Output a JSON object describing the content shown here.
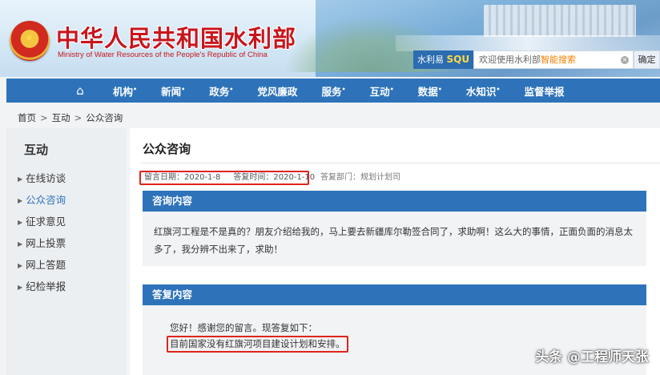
{
  "header": {
    "title": "中华人民共和国水利部",
    "subtitle": "Ministry of Water Resources of the People's Republic of China",
    "emblem_icon": "national-emblem-icon",
    "search": {
      "brand_prefix": "水利易",
      "brand_suffix": "SQU",
      "placeholder_prefix": "欢迎使用水利部",
      "placeholder_highlight": "智能搜索",
      "clear_icon": "close-icon",
      "button": "确定"
    }
  },
  "nav": {
    "home_icon": "home-icon",
    "items": [
      {
        "label": "机构",
        "mark": "•"
      },
      {
        "label": "新闻",
        "mark": "•"
      },
      {
        "label": "政务",
        "mark": "•"
      },
      {
        "label": "党风廉政",
        "mark": ""
      },
      {
        "label": "服务",
        "mark": "•"
      },
      {
        "label": "互动",
        "mark": "•"
      },
      {
        "label": "数据",
        "mark": "•"
      },
      {
        "label": "水知识",
        "mark": "•"
      },
      {
        "label": "监督举报",
        "mark": ""
      }
    ]
  },
  "breadcrumb": [
    "首页",
    "互动",
    "公众咨询"
  ],
  "sidebar": {
    "title": "互动",
    "items": [
      {
        "label": "在线访谈"
      },
      {
        "label": "公众咨询"
      },
      {
        "label": "征求意见"
      },
      {
        "label": "网上投票"
      },
      {
        "label": "网上答题"
      },
      {
        "label": "纪检举报"
      }
    ],
    "active_index": 1
  },
  "main": {
    "title": "公众咨询",
    "meta": {
      "message_date": "留言日期：2020-1-8",
      "reply_date": "答复时间：2020-1-10",
      "department": "答复部门：规划计划司"
    },
    "question": {
      "heading": "咨询内容",
      "text": "红旗河工程是不是真的？朋友介绍给我的，马上要去新疆库尔勒签合同了，求助啊！这么大的事情，正面负面的消息太多了，我分辨不出来了，求助！"
    },
    "answer": {
      "heading": "答复内容",
      "greeting": "您好！感谢您的留言。现答复如下：",
      "text": "目前国家没有红旗河项目建设计划和安排。"
    }
  },
  "watermark": "头条 @工程师天张",
  "colors": {
    "nav_blue": "#2e73ba",
    "brand_red": "#c8161d",
    "highlight_red": "#e0241d",
    "search_accent": "#f08300"
  }
}
